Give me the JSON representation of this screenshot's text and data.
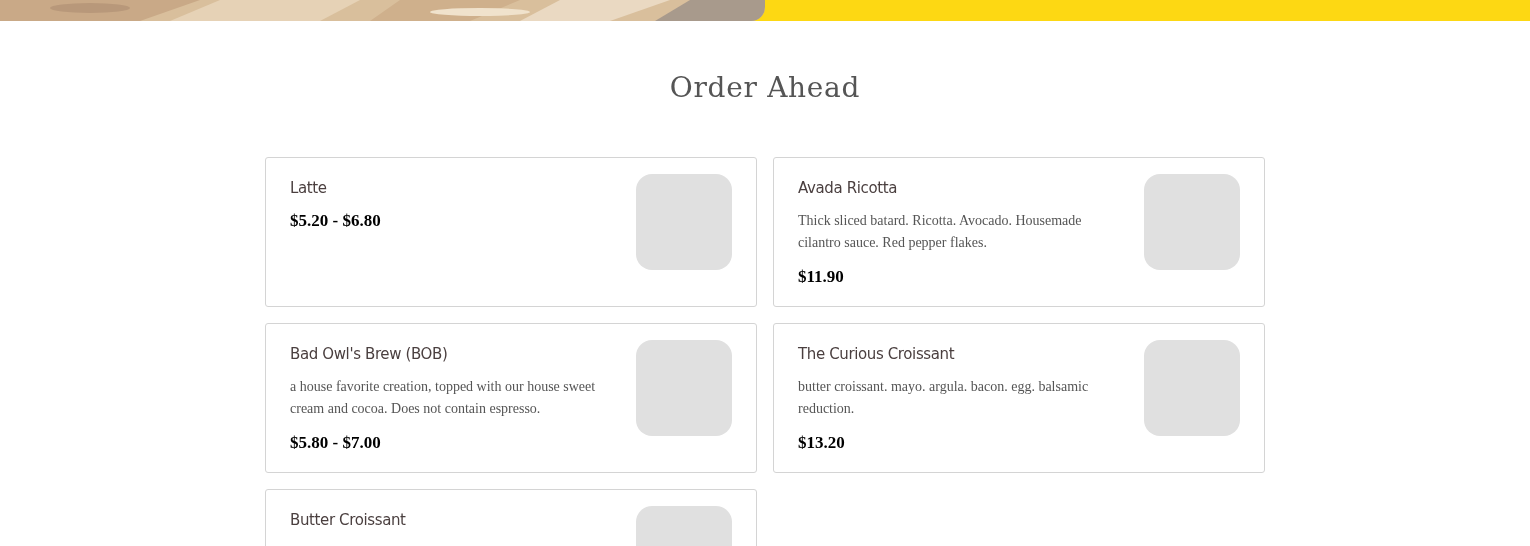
{
  "heading": "Order Ahead",
  "items": [
    {
      "name": "Latte",
      "price": "$5.20 - $6.80"
    },
    {
      "name": "Avada Ricotta",
      "description": "Thick sliced batard. Ricotta. Avocado. Housemade cilantro sauce. Red pepper flakes.",
      "price": "$11.90"
    },
    {
      "name": "Bad Owl's Brew (BOB)",
      "description": "a house favorite creation, topped with our house sweet cream and cocoa. Does not contain espresso.",
      "price": "$5.80 - $7.00"
    },
    {
      "name": "The Curious Croissant",
      "description": "butter croissant. mayo. argula. bacon. egg. balsamic reduction.",
      "price": "$13.20"
    },
    {
      "name": "Butter Croissant"
    }
  ]
}
